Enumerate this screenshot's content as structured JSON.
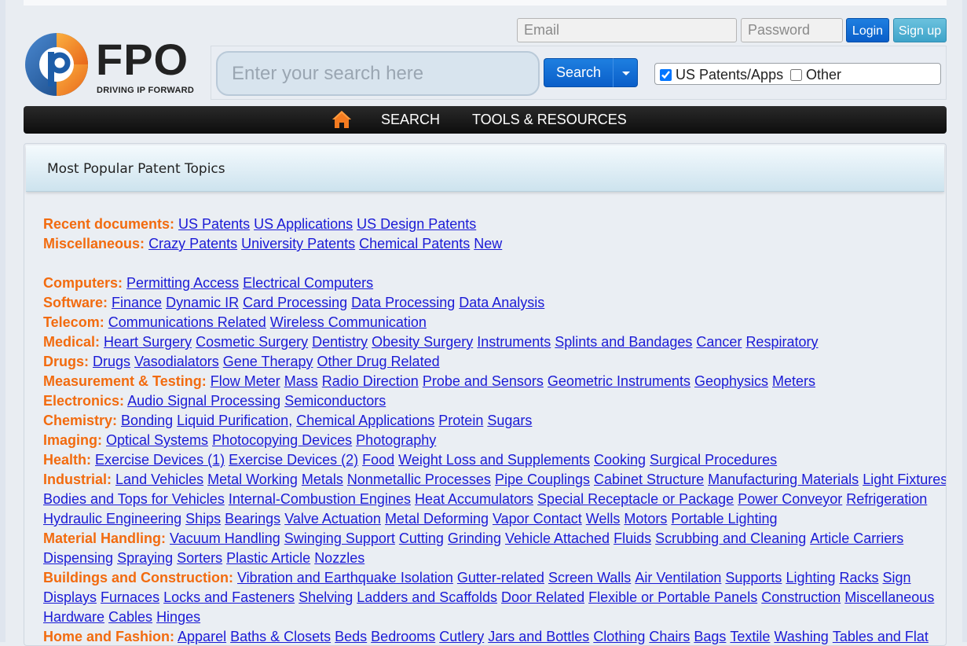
{
  "auth": {
    "email_placeholder": "Email",
    "password_placeholder": "Password",
    "login_label": "Login",
    "signup_label": "Sign up"
  },
  "logo": {
    "wordmark": "FPO",
    "tagline": "DRIVING IP FORWARD",
    "colors": {
      "orange": "#f47b20",
      "blue": "#1d5da8",
      "text": "#222222"
    }
  },
  "search": {
    "placeholder": "Enter your search here",
    "button_label": "Search",
    "scope_us_label": "US Patents/Apps",
    "scope_us_checked": true,
    "scope_other_label": "Other",
    "scope_other_checked": false
  },
  "nav": {
    "home_icon": "home-icon",
    "items": [
      "SEARCH",
      "TOOLS & RESOURCES"
    ]
  },
  "panel": {
    "title": "Most Popular Patent Topics"
  },
  "topics": [
    {
      "category": "Recent documents:",
      "links": [
        "US Patents",
        "US Applications",
        "US Design Patents"
      ]
    },
    {
      "category": "Miscellaneous:",
      "links": [
        "Crazy Patents",
        "University Patents",
        "Chemical Patents",
        "New"
      ]
    },
    {
      "spacer": true
    },
    {
      "category": "Computers:",
      "links": [
        "Permitting Access",
        "Electrical Computers"
      ]
    },
    {
      "category": "Software:",
      "links": [
        "Finance",
        "Dynamic IR",
        "Card Processing",
        "Data Processing",
        "Data Analysis"
      ]
    },
    {
      "category": "Telecom:",
      "links": [
        "Communications Related",
        "Wireless Communication"
      ]
    },
    {
      "category": "Medical:",
      "links": [
        "Heart Surgery",
        "Cosmetic Surgery",
        "Dentistry",
        "Obesity Surgery",
        "Instruments",
        "Splints and Bandages",
        "Cancer",
        "Respiratory"
      ]
    },
    {
      "category": "Drugs:",
      "links": [
        "Drugs",
        "Vasodialators",
        "Gene Therapy",
        "Other Drug Related"
      ]
    },
    {
      "category": "Measurement & Testing:",
      "links": [
        "Flow Meter",
        "Mass",
        "Radio Direction",
        "Probe and Sensors",
        "Geometric Instruments",
        "Geophysics",
        "Meters"
      ]
    },
    {
      "category": "Electronics:",
      "links": [
        "Audio Signal Processing",
        "Semiconductors"
      ]
    },
    {
      "category": "Chemistry:",
      "links": [
        "Bonding",
        "Liquid Purification,",
        "Chemical Applications",
        "Protein",
        "Sugars"
      ]
    },
    {
      "category": "Imaging:",
      "links": [
        "Optical Systems",
        "Photocopying Devices",
        "Photography"
      ]
    },
    {
      "category": "Health:",
      "links": [
        "Exercise Devices (1)",
        "Exercise Devices (2)",
        "Food",
        "Weight Loss and Supplements",
        "Cooking",
        "Surgical Procedures"
      ]
    },
    {
      "category": "Industrial:",
      "links": [
        "Land Vehicles",
        "Metal Working",
        "Metals",
        "Nonmetallic Processes",
        "Pipe Couplings",
        "Cabinet Structure",
        "Manufacturing Materials",
        "Light Fixtures"
      ]
    },
    {
      "category": "",
      "links": [
        "Bodies and Tops for Vehicles",
        "Internal-Combustion Engines",
        "Heat Accumulators",
        "Special Receptacle or Package",
        "Power Conveyor",
        "Refrigeration"
      ]
    },
    {
      "category": "",
      "links": [
        "Hydraulic Engineering",
        "Ships",
        "Bearings",
        "Valve Actuation",
        "Metal Deforming",
        "Vapor Contact",
        "Wells",
        "Motors",
        "Portable Lighting"
      ]
    },
    {
      "category": "Material Handling:",
      "links": [
        "Vacuum Handling",
        "Swinging Support",
        "Cutting",
        "Grinding",
        "Vehicle Attached",
        "Fluids",
        "Scrubbing and Cleaning",
        "Article Carriers"
      ]
    },
    {
      "category": "",
      "links": [
        "Dispensing",
        "Spraying",
        "Sorters",
        "Plastic Article",
        "Nozzles"
      ]
    },
    {
      "category": "Buildings and Construction:",
      "links": [
        "Vibration and Earthquake Isolation",
        "Gutter-related",
        "Screen Walls",
        "Air Ventilation",
        "Supports",
        "Lighting",
        "Racks",
        "Sign"
      ]
    },
    {
      "category": "",
      "links": [
        "Displays",
        "Furnaces",
        "Locks and Fasteners",
        "Shelving",
        "Ladders and Scaffolds",
        "Door Related",
        "Flexible or Portable Panels",
        "Construction",
        "Miscellaneous"
      ]
    },
    {
      "category": "",
      "links": [
        "Hardware",
        "Cables",
        "Hinges"
      ]
    },
    {
      "category": "Home and Fashion:",
      "links": [
        "Apparel",
        "Baths & Closets",
        "Beds",
        "Bedrooms",
        "Cutlery",
        "Jars and Bottles",
        "Clothing",
        "Chairs",
        "Bags",
        "Textile",
        "Washing",
        "Tables and Flat"
      ]
    }
  ]
}
